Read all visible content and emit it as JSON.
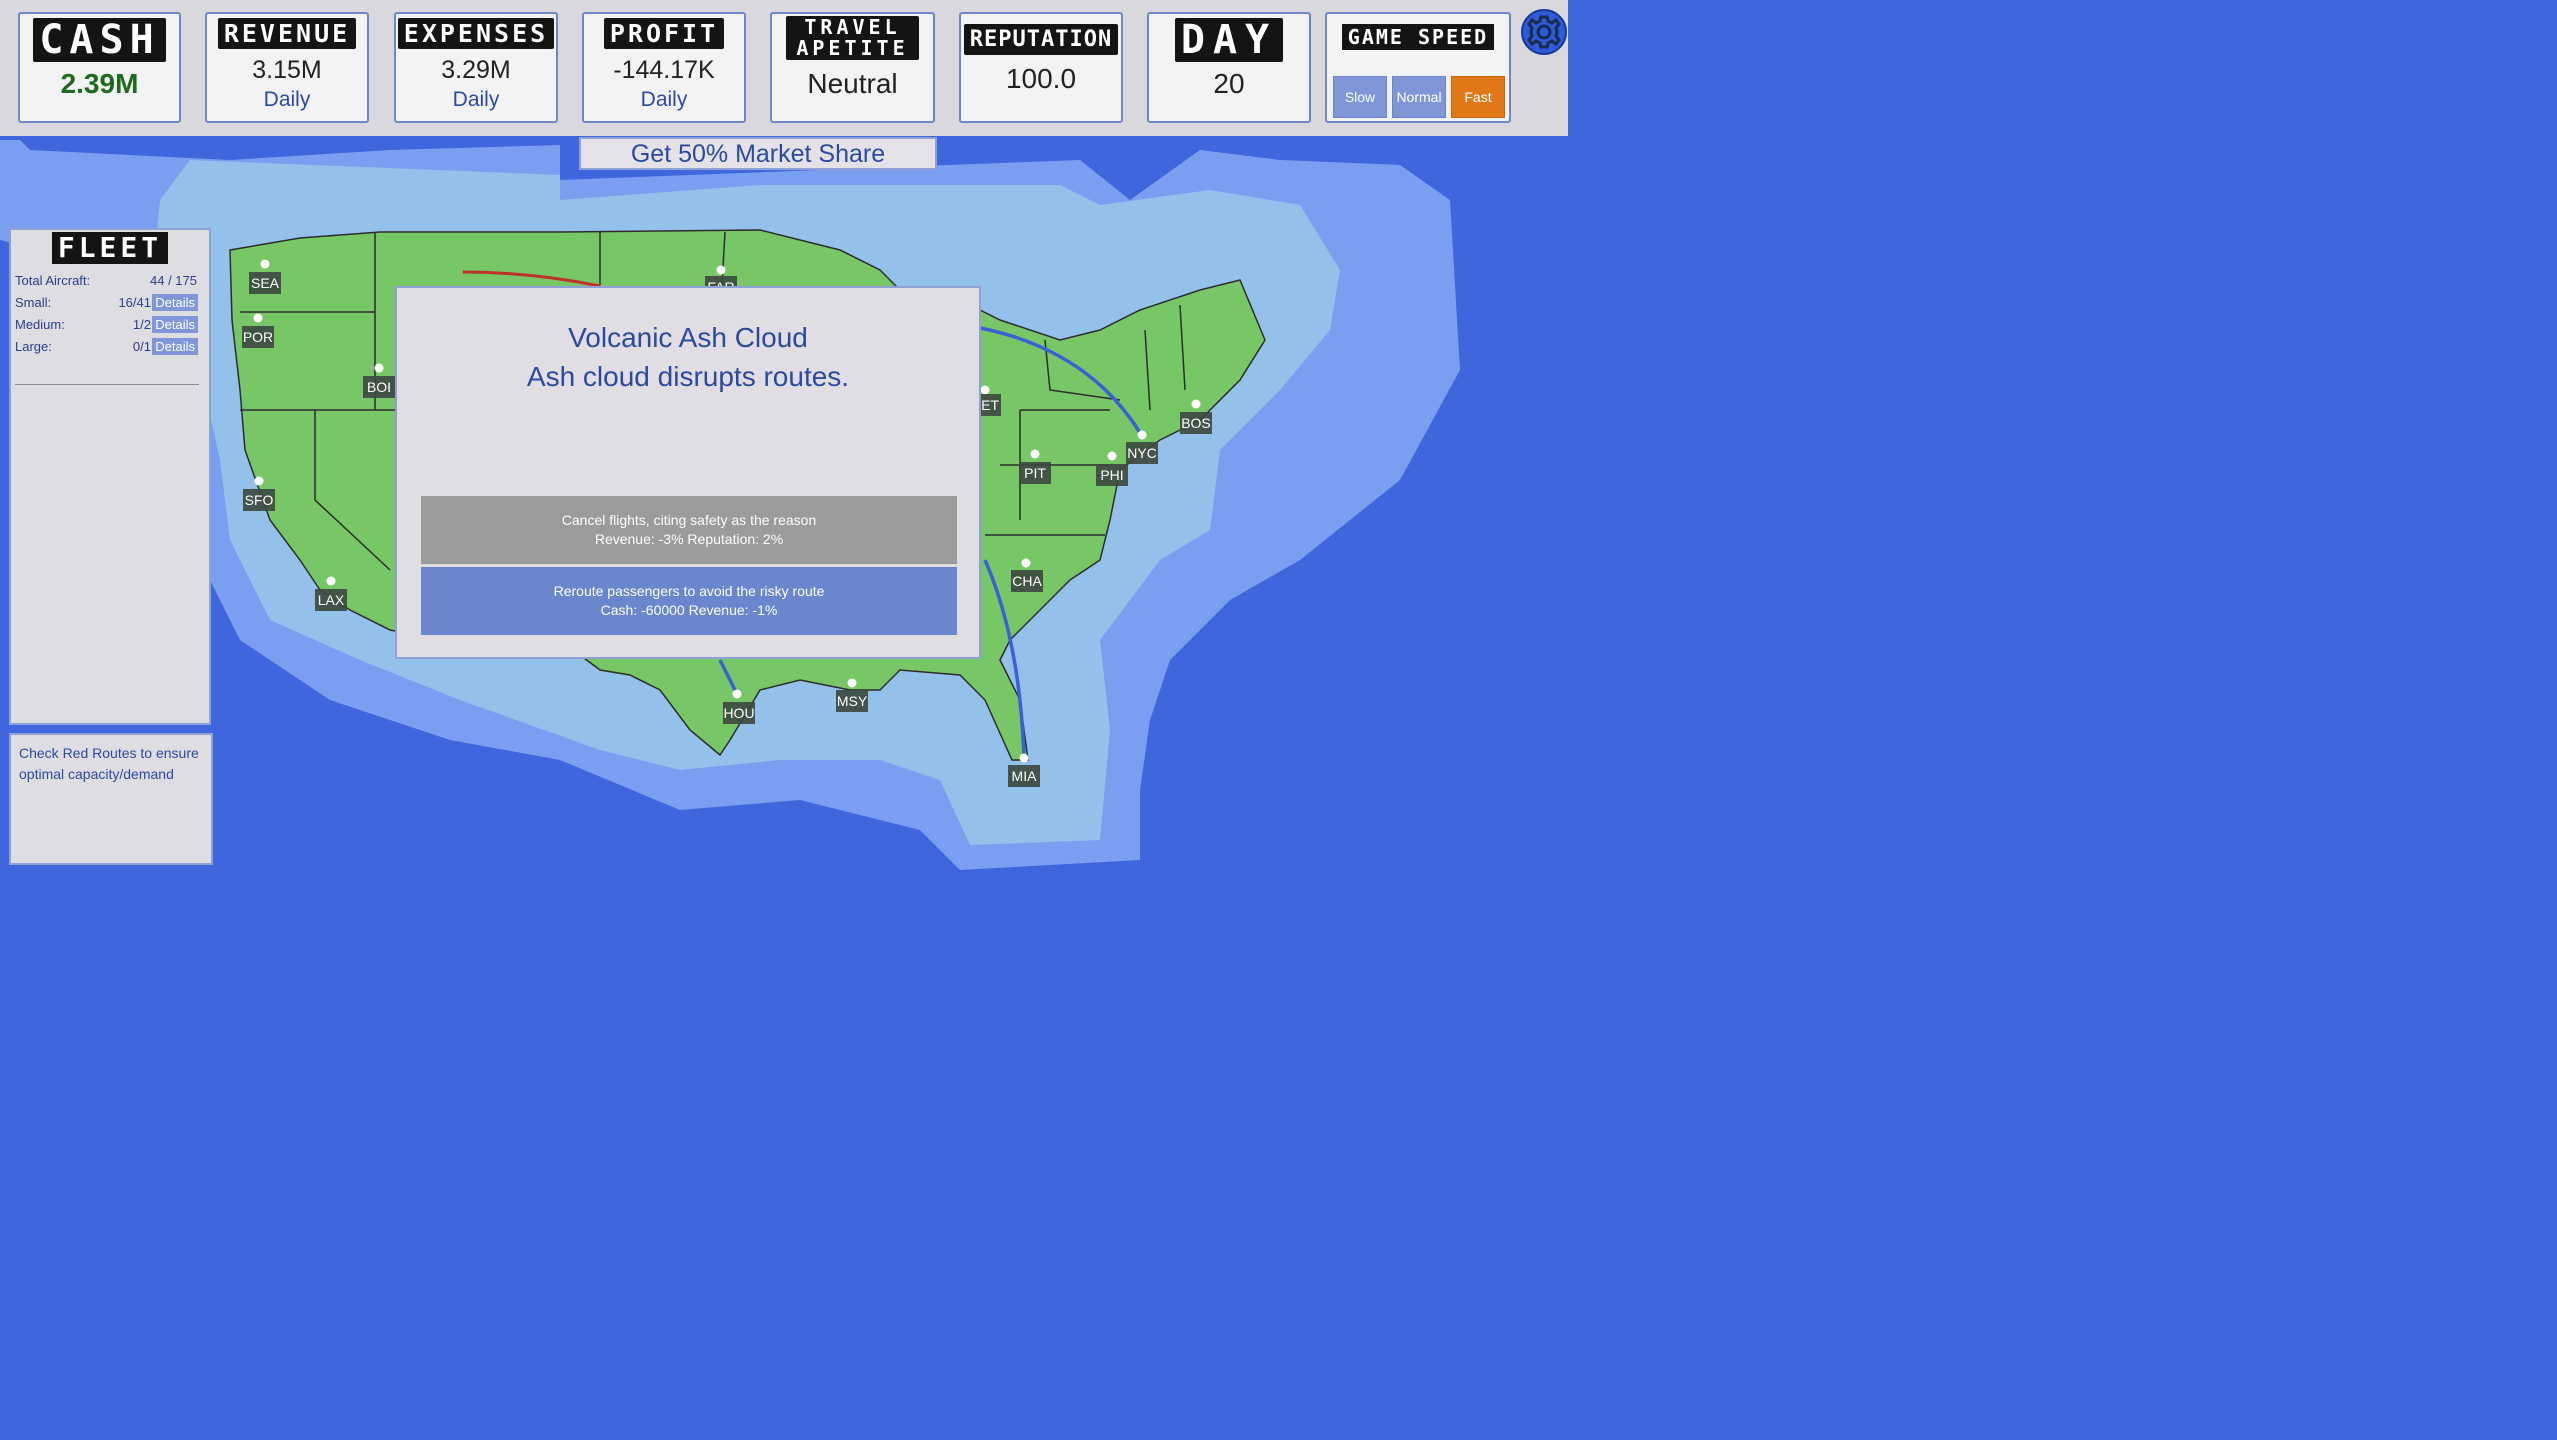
{
  "stats": {
    "cash": {
      "title": "CASH",
      "value": "2.39M"
    },
    "revenue": {
      "title": "REVENUE",
      "value": "3.15M",
      "period": "Daily"
    },
    "expenses": {
      "title": "EXPENSES",
      "value": "3.29M",
      "period": "Daily"
    },
    "profit": {
      "title": "PROFIT",
      "value": "-144.17K",
      "period": "Daily"
    },
    "travel": {
      "title_line1": "TRAVEL",
      "title_line2": "APETITE",
      "value": "Neutral"
    },
    "reputation": {
      "title": "REPUTATION",
      "value": "100.0"
    },
    "day": {
      "title": "DAY",
      "value": "20"
    }
  },
  "game_speed": {
    "title": "GAME SPEED",
    "options": [
      "Slow",
      "Normal",
      "Fast"
    ],
    "selected": "Fast"
  },
  "settings": {
    "icon": "gear-icon"
  },
  "goal": "Get 50% Market Share",
  "fleet": {
    "title": "FLEET",
    "rows": [
      {
        "label": "Total Aircraft:",
        "count": "44 / 175"
      },
      {
        "label": "Small:",
        "count": "16/41",
        "action": "Details"
      },
      {
        "label": "Medium:",
        "count": "1/2",
        "action": "Details"
      },
      {
        "label": "Large:",
        "count": "0/1",
        "action": "Details"
      }
    ]
  },
  "tip": "Check Red Routes to ensure optimal capacity/demand",
  "event": {
    "title": "Volcanic Ash Cloud",
    "description": "Ash cloud disrupts routes.",
    "options": [
      {
        "text": "Cancel flights, citing safety as the reason",
        "effects": "Revenue: -3% Reputation: 2%"
      },
      {
        "text": "Reroute passengers to avoid the risky route",
        "effects": "Cash: -60000 Revenue: -1%"
      }
    ]
  },
  "cities": [
    "SEA",
    "POR",
    "BOI",
    "SFO",
    "LAX",
    "HOU",
    "MSY",
    "MIA",
    "CHA",
    "PIT",
    "PHI",
    "NYC",
    "BOS",
    "FAR",
    "DET"
  ],
  "colors": {
    "ocean_deep": "#3f66dc",
    "ocean_mid": "#7b9ff0",
    "ocean_shallow": "#93c1ea",
    "land": "#78c766",
    "route_blue": "#3c5fd8",
    "route_red": "#c0312b",
    "fast_active": "#e07818"
  }
}
